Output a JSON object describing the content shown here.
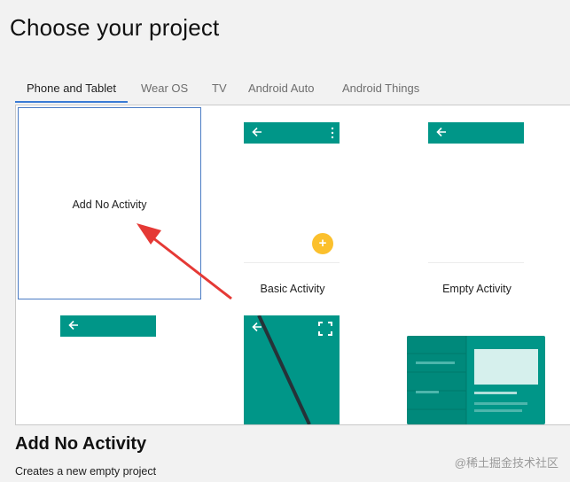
{
  "page": {
    "title": "Choose your project"
  },
  "tabs": [
    {
      "label": "Phone and Tablet",
      "active": true
    },
    {
      "label": "Wear OS",
      "active": false
    },
    {
      "label": "TV",
      "active": false
    },
    {
      "label": "Android Auto",
      "active": false
    },
    {
      "label": "Android Things",
      "active": false
    }
  ],
  "templates": {
    "no_activity": {
      "label": "Add No Activity",
      "selected": true
    },
    "basic_activity": {
      "label": "Basic Activity",
      "fab_symbol": "+"
    },
    "empty_activity": {
      "label": "Empty Activity"
    }
  },
  "details": {
    "title": "Add No Activity",
    "description": "Creates a new empty project"
  },
  "watermark": "@稀土掘金技术社区",
  "colors": {
    "appbar": "#009688",
    "fab": "#fbc02d",
    "selection": "#4a7bc4",
    "annotation_arrow": "#e53935",
    "tab_underline": "#3a7bd5"
  },
  "icons": [
    "back-arrow-icon",
    "overflow-menu-icon",
    "fullscreen-icon",
    "add-icon"
  ]
}
